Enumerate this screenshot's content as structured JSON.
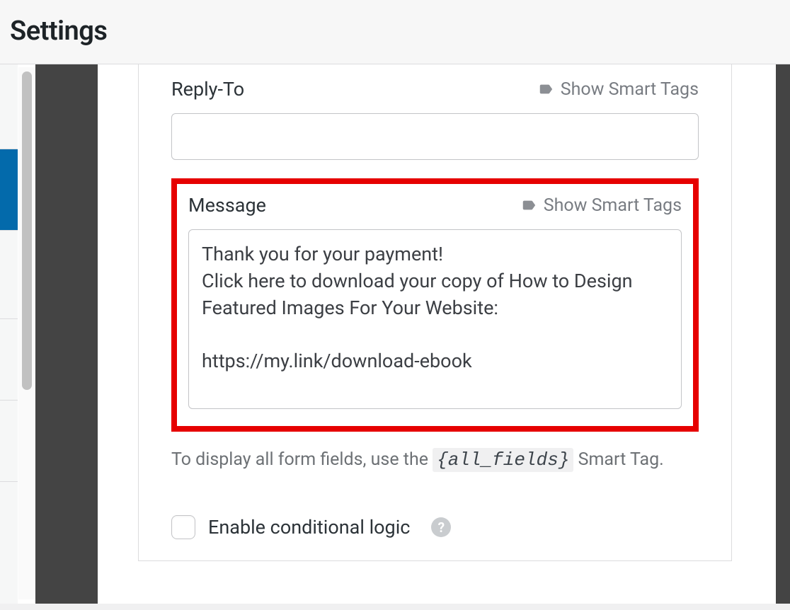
{
  "header": {
    "title": "Settings"
  },
  "form": {
    "replyTo": {
      "label": "Reply-To",
      "smartTagsLabel": "Show Smart Tags",
      "value": ""
    },
    "message": {
      "label": "Message",
      "smartTagsLabel": "Show Smart Tags",
      "value": "Thank you for your payment!\nClick here to download your copy of How to Design Featured Images For Your Website:\n\nhttps://my.link/download-ebook"
    },
    "helpText": {
      "prefix": "To display all form fields, use the ",
      "code": "{all_fields}",
      "suffix": " Smart Tag."
    },
    "conditionalLogic": {
      "label": "Enable conditional logic"
    }
  }
}
